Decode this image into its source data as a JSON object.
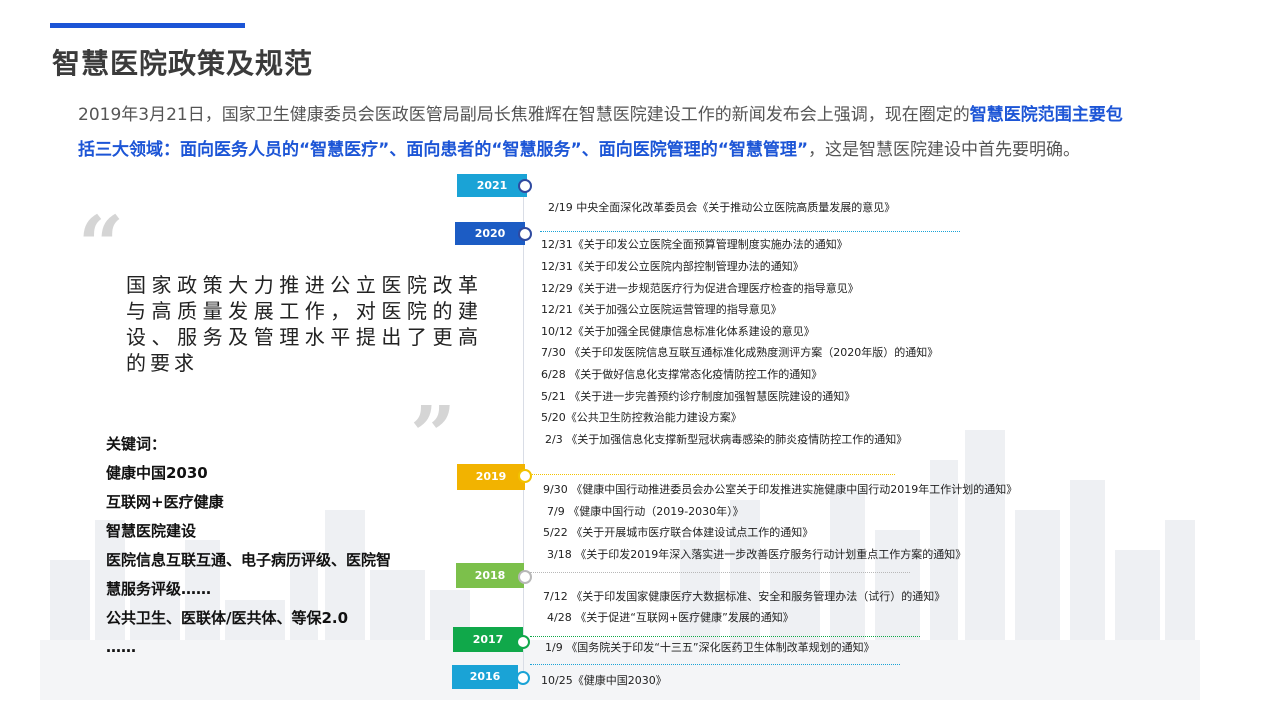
{
  "page_title": "智慧医院政策及规范",
  "intro": {
    "part1": "2019年3月21日，国家卫生健康委员会医政医管局副局长焦雅辉在智慧医院建设工作的新闻发布会上强调，现在圈定的",
    "highlight": "智慧医院范围主要包括三大领域：面向医务人员的“智慧医疗”、面向患者的“智慧服务”、面向医院管理的“智慧管理”",
    "part2": "，这是智慧医院建设中首先要明确。"
  },
  "quote": {
    "open_mark": "“",
    "close_mark": "”",
    "text": "国家政策大力推进公立医院改革与高质量发展工作，对医院的建设、服务及管理水平提出了更高的要求"
  },
  "keywords": {
    "label": "关键词：",
    "lines": [
      "健康中国2030",
      "互联网+医疗健康",
      "智慧医院建设",
      "医院信息互联互通、电子病历评级、医院智",
      "慧服务评级……",
      "公共卫生、医联体/医共体、等保2.0",
      "……"
    ]
  },
  "timeline": {
    "years": [
      {
        "year": "2021",
        "color": "#1aa3d6",
        "node_color": "#2f4aa0"
      },
      {
        "year": "2020",
        "color": "#1c5cc4",
        "node_color": "#2f4aa0"
      },
      {
        "year": "2019",
        "color": "#f2b300",
        "node_color": "#f2c200"
      },
      {
        "year": "2018",
        "color": "#7cc04b",
        "node_color": "#b8b8b8"
      },
      {
        "year": "2017",
        "color": "#10a84a",
        "node_color": "#10a84a"
      },
      {
        "year": "2016",
        "color": "#1aa3d6",
        "node_color": "#1aa3d6"
      }
    ],
    "items": [
      "2/19 中央全面深化改革委员会《关于推动公立医院高质量发展的意见》",
      "12/31《关于印发公立医院全面预算管理制度实施办法的通知》",
      "12/31《关于印发公立医院内部控制管理办法的通知》",
      "12/29《关于进一步规范医疗行为促进合理医疗检查的指导意见》",
      "12/21《关于加强公立医院运营管理的指导意见》",
      "10/12《关于加强全民健康信息标准化体系建设的意见》",
      "7/30 《关于印发医院信息互联互通标准化成熟度测评方案（2020年版）的通知》",
      "6/28 《关于做好信息化支撑常态化疫情防控工作的通知》",
      "5/21 《关于进一步完善预约诊疗制度加强智慧医院建设的通知》",
      "5/20《公共卫生防控救治能力建设方案》",
      "2/3 《关于加强信息化支撑新型冠状病毒感染的肺炎疫情防控工作的通知》",
      "9/30 《健康中国行动推进委员会办公室关于印发推进实施健康中国行动2019年工作计划的通知》",
      "7/9 《健康中国行动（2019-2030年）》",
      "5/22 《关于开展城市医疗联合体建设试点工作的通知》",
      "3/18 《关于印发2019年深入落实进一步改善医疗服务行动计划重点工作方案的通知》",
      "7/12 《关于印发国家健康医疗大数据标准、安全和服务管理办法（试行）的通知》",
      "4/28 《关于促进“互联网+医疗健康”发展的通知》",
      "1/9 《国务院关于印发“十三五”深化医药卫生体制改革规划的通知》",
      "10/25《健康中国2030》"
    ]
  }
}
